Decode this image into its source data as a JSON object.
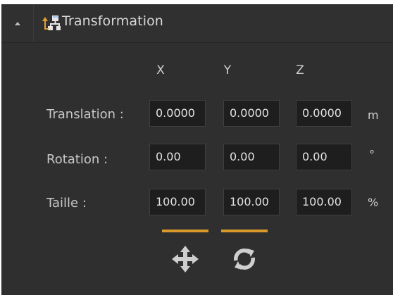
{
  "header": {
    "title": "Transformation",
    "collapse_icon": "collapse-up-icon",
    "section_icon": "hierarchy-icon"
  },
  "axes": [
    "X",
    "Y",
    "Z"
  ],
  "rows": [
    {
      "label": "Translation :",
      "values": [
        "0.0000",
        "0.0000",
        "0.0000"
      ],
      "unit": "m"
    },
    {
      "label": "Rotation :",
      "values": [
        "0.00",
        "0.00",
        "0.00"
      ],
      "unit": "°"
    },
    {
      "label": "Taille :",
      "values": [
        "100.00",
        "100.00",
        "100.00"
      ],
      "unit": "%"
    }
  ],
  "tools": [
    {
      "name": "move",
      "icon": "move-icon",
      "active": true
    },
    {
      "name": "rotate",
      "icon": "rotate-icon",
      "active": true
    }
  ],
  "colors": {
    "panel_bg": "#2f2f2f",
    "field_bg": "#1e1e1e",
    "accent": "#d99a2b",
    "tool_icon": "#cfcfcf"
  }
}
